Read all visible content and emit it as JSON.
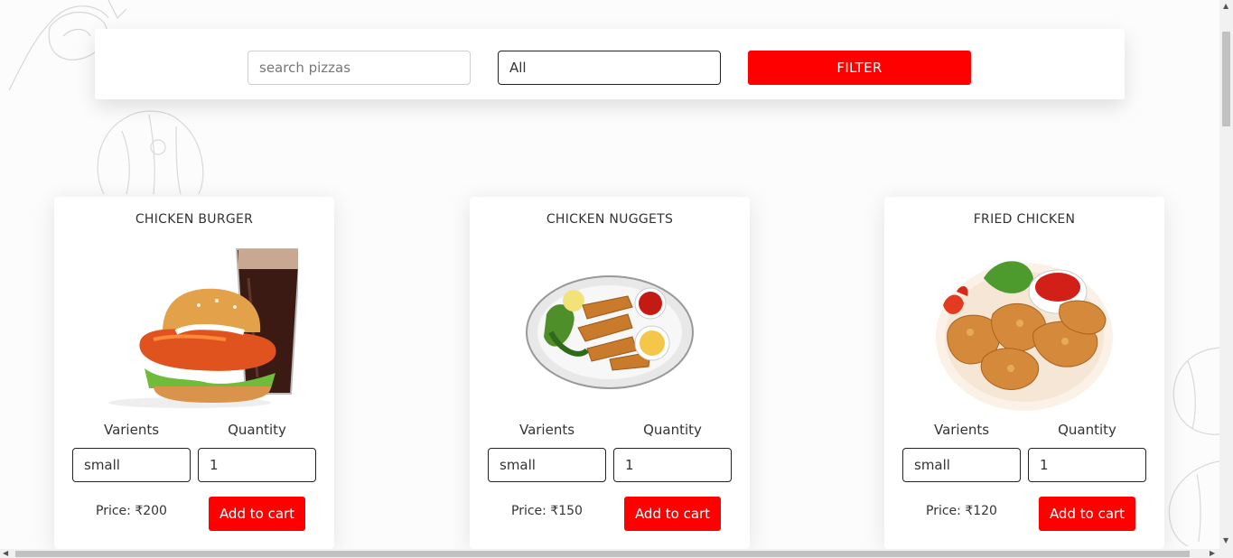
{
  "filter": {
    "search_placeholder": "search pizzas",
    "category_value": "All",
    "filter_label": "FILTER"
  },
  "labels": {
    "varients": "Varients",
    "quantity": "Quantity",
    "add_to_cart": "Add to cart"
  },
  "products": [
    {
      "name": "CHICKEN BURGER",
      "variant": "small",
      "quantity": "1",
      "price": "Price: ₹200"
    },
    {
      "name": "CHICKEN NUGGETS",
      "variant": "small",
      "quantity": "1",
      "price": "Price: ₹150"
    },
    {
      "name": "FRIED CHICKEN",
      "variant": "small",
      "quantity": "1",
      "price": "Price: ₹120"
    }
  ],
  "colors": {
    "accent": "#ff0000"
  }
}
